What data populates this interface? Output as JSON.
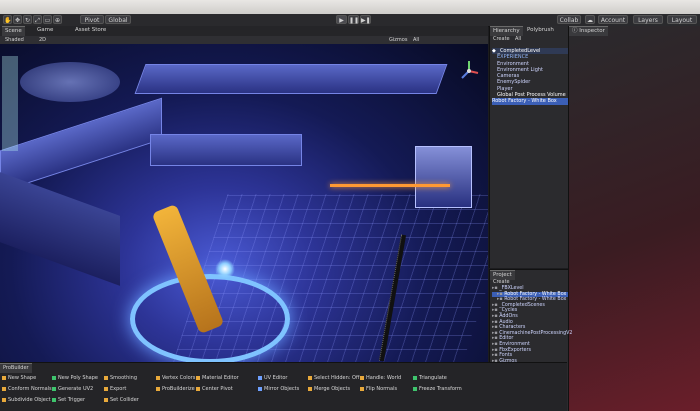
{
  "toolbar": {
    "pivot": "Pivot",
    "global": "Global",
    "collab": "Collab",
    "account": "Account",
    "layers": "Layers",
    "layout": "Layout"
  },
  "scene_tabs": [
    "Scene",
    "Game",
    "Asset Store"
  ],
  "scene_toolbar": {
    "shading": "Shaded",
    "mode_2d": "2D",
    "gizmos": "Gizmos",
    "search": "All"
  },
  "hierarchy": {
    "tabs": [
      "Hierarchy",
      "Polybrush"
    ],
    "create": "Create",
    "search": "All",
    "items": [
      {
        "label": "_CompletedLevel",
        "level": 0
      },
      {
        "label": "EXPERIENCE",
        "level": 1
      },
      {
        "label": "Environment",
        "level": 1
      },
      {
        "label": "Environment Light",
        "level": 1
      },
      {
        "label": "Cameras",
        "level": 1
      },
      {
        "label": "EnemySpider",
        "level": 1
      },
      {
        "label": "Player",
        "level": 1
      },
      {
        "label": "Global Post Process Volume",
        "level": 1
      },
      {
        "label": "Robot Factory - White Box",
        "level": 0
      }
    ]
  },
  "inspector": {
    "tab": "Inspector"
  },
  "project": {
    "tab": "Project",
    "create": "Create",
    "items": [
      {
        "label": "_FBXLevel",
        "level": 0
      },
      {
        "label": "Robot Factory - White Box",
        "level": 1
      },
      {
        "label": "Robot Factory - White Box",
        "level": 1
      },
      {
        "label": "_CompletedScenes",
        "level": 0
      },
      {
        "label": "_Cycles",
        "level": 0
      },
      {
        "label": "AddOns",
        "level": 0
      },
      {
        "label": "Audio",
        "level": 0
      },
      {
        "label": "Characters",
        "level": 0
      },
      {
        "label": "CinemachinePostProcessingV2",
        "level": 0
      },
      {
        "label": "Editor",
        "level": 0
      },
      {
        "label": "Environment",
        "level": 0
      },
      {
        "label": "FbxExporters",
        "level": 0
      },
      {
        "label": "Fonts",
        "level": 0
      },
      {
        "label": "Gizmos",
        "level": 0
      },
      {
        "label": "Scene",
        "level": 0
      },
      {
        "label": "PostProcessingProfiles",
        "level": 0
      },
      {
        "label": "Prefabs",
        "level": 0
      },
      {
        "label": "ProBuilder",
        "level": 0
      },
      {
        "label": "ProBuilder Data",
        "level": 0
      },
      {
        "label": "ProBuilderAssets",
        "level": 0
      },
      {
        "label": "ProCore",
        "level": 0
      },
      {
        "label": "Projectiles",
        "level": 0
      }
    ]
  },
  "probuilder": {
    "tab": "ProBuilder",
    "columns": [
      [
        "New Shape",
        "Conform Normals",
        "Subdivide Object"
      ],
      [
        "New Poly Shape",
        "Generate UV2",
        "Set Trigger"
      ],
      [
        "Smoothing",
        "Export",
        "Set Collider"
      ],
      [
        "Vertex Colors",
        "ProBuilderize"
      ],
      [
        "Material Editor",
        "Center Pivot"
      ],
      [
        "UV Editor",
        "Mirror Objects"
      ],
      [
        "Select Hidden: Off",
        "Merge Objects"
      ],
      [
        "Handle: World",
        "Flip Normals"
      ],
      [
        "Triangulate",
        "Freeze Transform"
      ]
    ]
  },
  "colors": {
    "editor_bg": "#1c1c1f",
    "panel_bg": "#2a2a2d",
    "selection": "#3b5fb6",
    "accent_orange": "#f2a93b",
    "accent_green": "#3ec46d",
    "accent_yellow": "#e6c229"
  },
  "icons": [
    "hand-icon",
    "move-icon",
    "rotate-icon",
    "scale-icon",
    "rect-icon",
    "transform-icon",
    "play-icon",
    "pause-icon",
    "step-icon",
    "cloud-icon",
    "history-icon",
    "folder-icon",
    "gizmo-axes-icon"
  ]
}
